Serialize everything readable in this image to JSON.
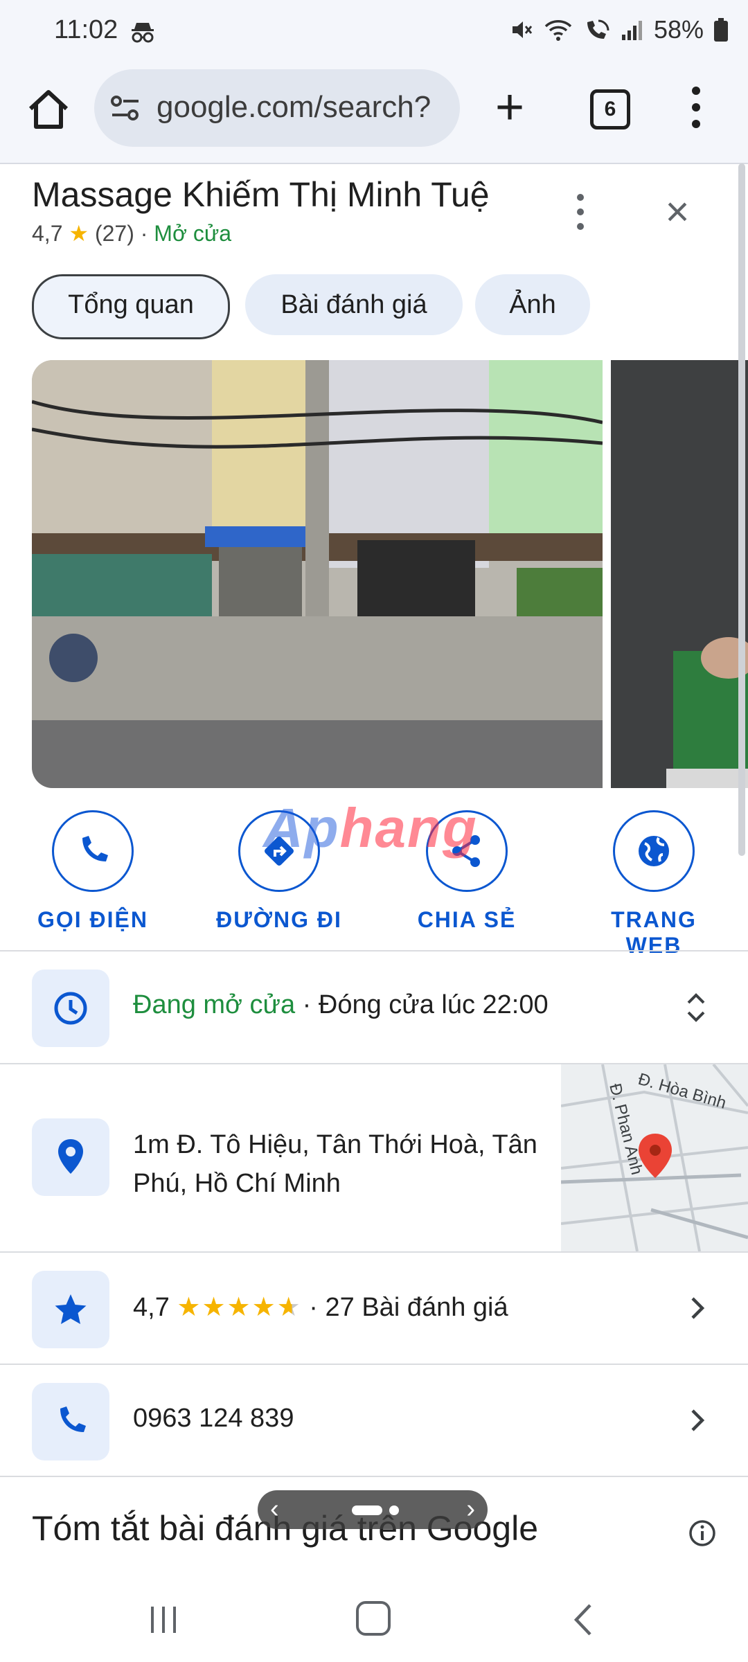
{
  "status_bar": {
    "time": "11:02",
    "battery": "58%",
    "icons": [
      "incognito-icon",
      "mute-icon",
      "wifi-icon",
      "wifi-calling-icon",
      "signal-icon",
      "battery-icon"
    ]
  },
  "browser": {
    "url": "google.com/search?",
    "tab_count": "6"
  },
  "place": {
    "name": "Massage Khiếm Thị Minh Tuệ",
    "rating": "4,7",
    "review_count": "(27)",
    "separator": "·",
    "status": "Mở cửa"
  },
  "tabs": [
    {
      "label": "Tổng quan",
      "active": true
    },
    {
      "label": "Bài đánh giá",
      "active": false
    },
    {
      "label": "Ảnh",
      "active": false
    }
  ],
  "actions": [
    {
      "label": "GỌI ĐIỆN",
      "icon": "phone-icon"
    },
    {
      "label": "ĐƯỜNG ĐI",
      "icon": "directions-icon"
    },
    {
      "label": "CHIA SẺ",
      "icon": "share-icon"
    },
    {
      "label": "TRANG WEB",
      "icon": "globe-icon"
    }
  ],
  "watermark": {
    "part1": "Ap",
    "part2": "hang"
  },
  "hours": {
    "status": "Đang mở cửa",
    "detail": " · Đóng cửa lúc 22:00"
  },
  "address": {
    "line1": "1m Đ. Tô Hiệu, Tân Thới Hoà, Tân",
    "line2": "Phú, Hồ Chí Minh",
    "map_label_1": "Đ. Hòa Bình",
    "map_label_2": "Đ. Phan Anh"
  },
  "reviews": {
    "rating": "4,7",
    "stars": 4.7,
    "separator": "·",
    "count_label": "27 Bài đánh giá"
  },
  "phone": {
    "number": "0963 124 839"
  },
  "summary": {
    "title": "Tóm tắt bài đánh giá trên Google"
  },
  "colors": {
    "accent": "#0b57d0",
    "open_green": "#1e8e3e",
    "star": "#f6b400",
    "chip_bg": "#e6edf8"
  }
}
